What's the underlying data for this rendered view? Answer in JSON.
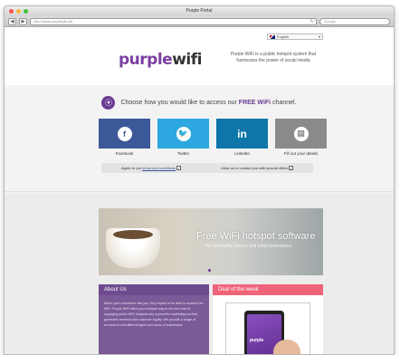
{
  "browser": {
    "window_title": "Purple Portal",
    "url": "http://www.purplewifi.net",
    "search_placeholder": "Google",
    "back_label": "◀",
    "forward_label": "▶",
    "reload_label": "↻"
  },
  "language": {
    "selected": "English"
  },
  "logo": {
    "part1": "purple",
    "part2": "wifi"
  },
  "tagline": "Purple WiFi is a public hotspot system that harnesses the power of social media",
  "prompt": {
    "before": "Choose how you would like to access our",
    "highlight": "FREE WiFi",
    "after": "channel."
  },
  "social": [
    {
      "label": "Facebook",
      "glyph": "f",
      "icon": "facebook-icon",
      "color": "#3b5998"
    },
    {
      "label": "Twitter",
      "glyph": "🐦",
      "icon": "twitter-icon",
      "color": "#2ca7e0"
    },
    {
      "label": "LinkedIn",
      "glyph": "in",
      "icon": "linkedin-icon",
      "color": "#0e76a8"
    },
    {
      "label": "Fill out your details",
      "glyph": "▤",
      "icon": "form-icon",
      "color": "#8a8a8a"
    }
  ],
  "agree": {
    "terms_prefix": "Agree to our",
    "terms_link": "terms and conditions",
    "offers": "Allow us to contact you with special offers",
    "check": "✓"
  },
  "hero": {
    "title": "Free WiFi hotspot software",
    "subtitle": "for hospitality, leisure and retail businesses"
  },
  "about": {
    "title": "About Us",
    "body": "When your customers visit you, they expect to be able to access free WiFi. Purple WiFi offers you a simple way to turn the cost of supplying public WiFi hotspots into a powerful marketing tool that generates revenue and customer loyalty. We provide a range of services to suit different types and sizes of businesses."
  },
  "deal": {
    "title": "Deal of the week",
    "tablet_text": "purple"
  },
  "colors": {
    "brand_purple": "#6a3b92",
    "deal_pink": "#f0647a"
  }
}
